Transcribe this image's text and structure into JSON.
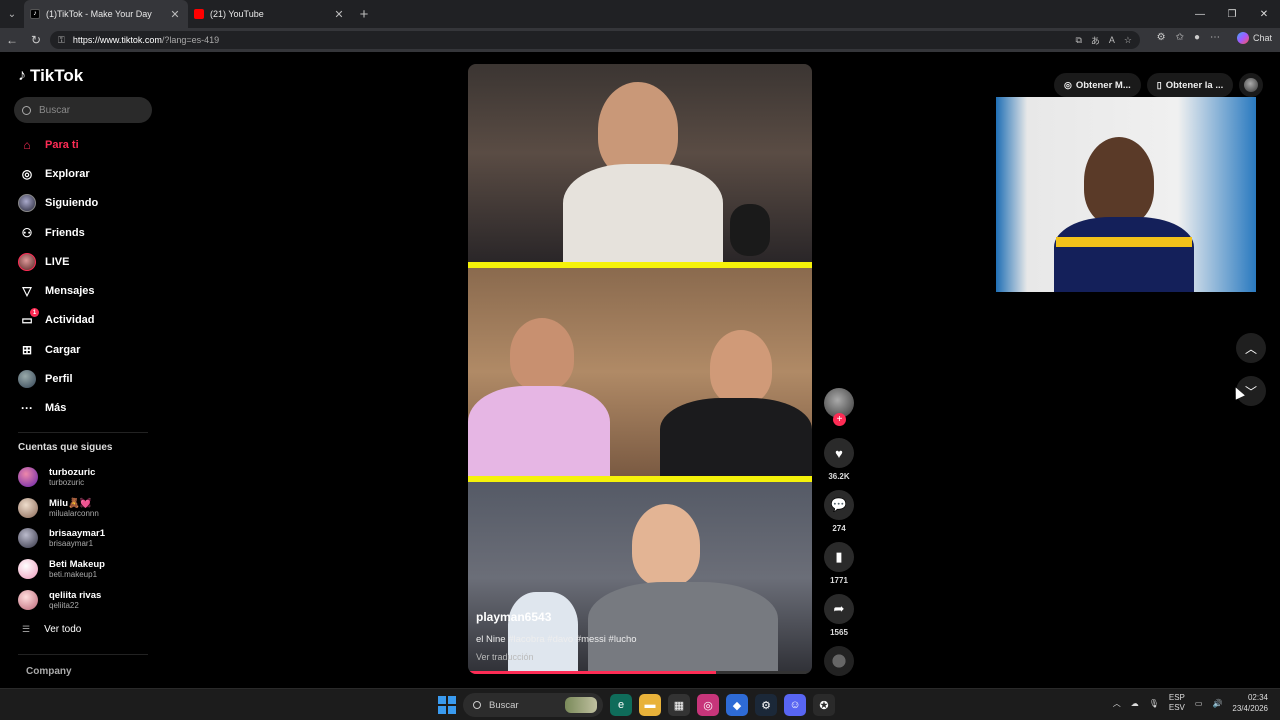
{
  "browser": {
    "tabs": [
      {
        "title": "(1)TikTok - Make Your Day",
        "active": true,
        "favicon": "tiktok-icon"
      },
      {
        "title": "(21) YouTube",
        "active": false,
        "favicon": "youtube-icon"
      }
    ],
    "url_host": "https://www.tiktok.com",
    "url_rest": "/?lang=es-419",
    "chat_label": "Chat"
  },
  "sidebar": {
    "brand": "TikTok",
    "search_placeholder": "Buscar",
    "nav": [
      {
        "label": "Para ti",
        "icon": "home-icon",
        "active": true
      },
      {
        "label": "Explorar",
        "icon": "compass-icon"
      },
      {
        "label": "Siguiendo",
        "icon": "following-avatar-icon"
      },
      {
        "label": "Friends",
        "icon": "friends-icon"
      },
      {
        "label": "LIVE",
        "icon": "live-avatar-icon"
      },
      {
        "label": "Mensajes",
        "icon": "send-icon"
      },
      {
        "label": "Actividad",
        "icon": "inbox-icon",
        "badge": "1"
      },
      {
        "label": "Cargar",
        "icon": "plus-square-icon"
      },
      {
        "label": "Perfil",
        "icon": "profile-avatar-icon"
      },
      {
        "label": "Más",
        "icon": "more-icon"
      }
    ],
    "following_title": "Cuentas que sigues",
    "following": [
      {
        "name": "turbozuric",
        "user": "turbozuric",
        "color": "#7a4fb0"
      },
      {
        "name": "Milu🧸💓",
        "user": "milualarconnn",
        "color": "#c9a08a"
      },
      {
        "name": "brisaaymar1",
        "user": "brisaaymar1",
        "color": "#556070"
      },
      {
        "name": "Beti Makeup",
        "user": "beti.makeup1",
        "color": "#f0c8d8"
      },
      {
        "name": "qeliita rivas",
        "user": "qeliita22",
        "color": "#d0a0a8"
      }
    ],
    "see_all": "Ver todo",
    "company": "Company"
  },
  "video": {
    "author": "playman6543",
    "description": "el Nine     #lacobra #davo #messi #lucho",
    "translate": "Ver traducción",
    "progress": 0.72
  },
  "actions": {
    "likes": "36.2K",
    "comments": "274",
    "saves": "1771",
    "shares": "1565"
  },
  "top_buttons": {
    "coins": "Obtener M...",
    "app": "Obtener la ..."
  },
  "taskbar": {
    "search": "Buscar",
    "lang_top": "ESP",
    "lang_bottom": "ESV",
    "time": "02:34",
    "date": "23/4/2026"
  }
}
